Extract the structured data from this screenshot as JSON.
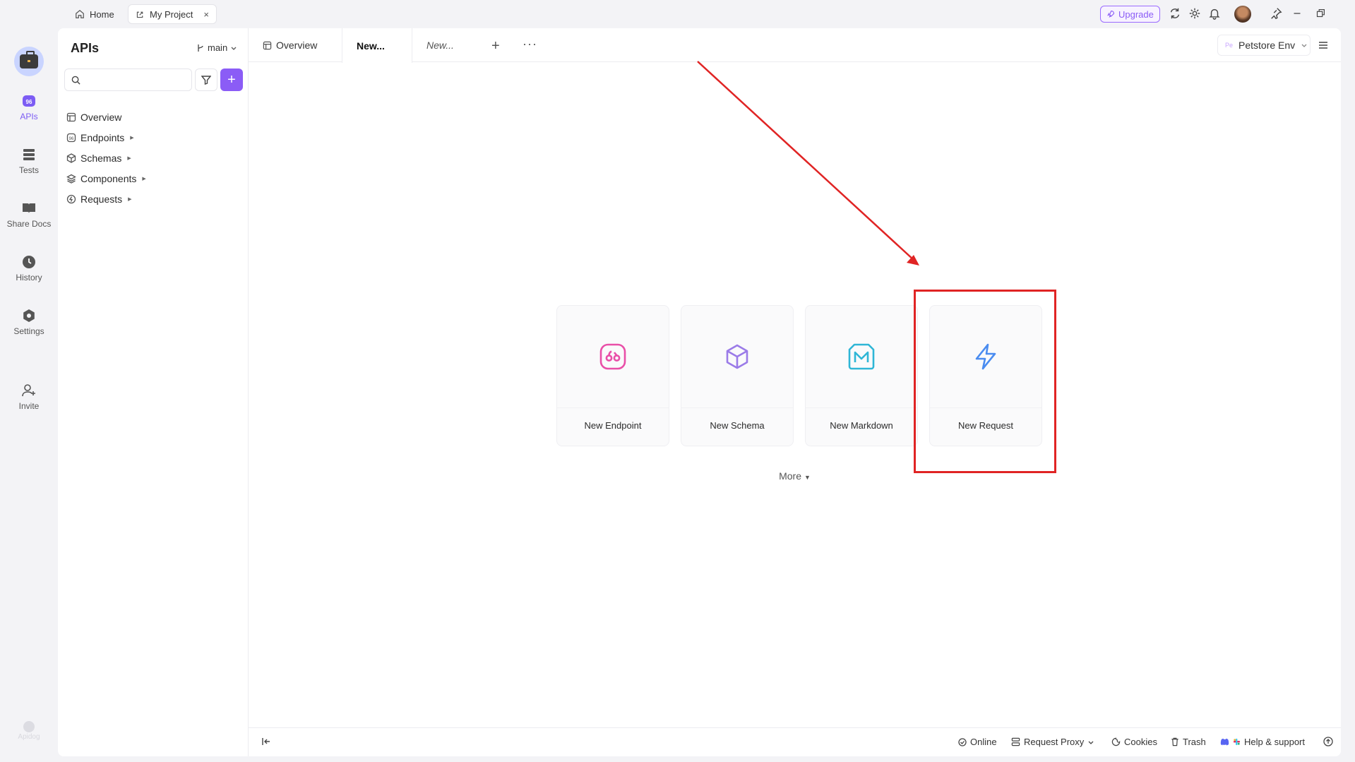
{
  "titlebar": {
    "home_tab": "Home",
    "project_tab": "My Project",
    "close": "×",
    "upgrade": "Upgrade"
  },
  "rail": {
    "items": [
      {
        "label": "APIs",
        "icon": "apis-icon"
      },
      {
        "label": "Tests",
        "icon": "tests-icon"
      },
      {
        "label": "Share Docs",
        "icon": "book-icon"
      },
      {
        "label": "History",
        "icon": "clock-icon"
      },
      {
        "label": "Settings",
        "icon": "gear-icon"
      },
      {
        "label": "Invite",
        "icon": "add-user-icon"
      }
    ],
    "bottom_logo": "Apidog"
  },
  "sidebar": {
    "title": "APIs",
    "branch": "main",
    "search_placeholder": "",
    "add": "+",
    "tree": [
      {
        "label": "Overview",
        "has_caret": false
      },
      {
        "label": "Endpoints",
        "has_caret": true
      },
      {
        "label": "Schemas",
        "has_caret": true
      },
      {
        "label": "Components",
        "has_caret": true
      },
      {
        "label": "Requests",
        "has_caret": true
      }
    ]
  },
  "main": {
    "tabs": [
      {
        "label": "Overview"
      },
      {
        "label": "New..."
      },
      {
        "label": "New..."
      }
    ],
    "plus": "+",
    "more_tabs": "···",
    "env_badge": "Pe",
    "env": "Petstore Env",
    "cards": [
      {
        "label": "New Endpoint",
        "icon": "endpoint-icon",
        "color": "#e94fa8"
      },
      {
        "label": "New Schema",
        "icon": "cube-icon",
        "color": "#9b7be8"
      },
      {
        "label": "New Markdown",
        "icon": "markdown-icon",
        "color": "#2fb6d6"
      },
      {
        "label": "New Request",
        "icon": "lightning-icon",
        "color": "#4a8cf0"
      }
    ],
    "more": "More"
  },
  "statusbar": {
    "online": "Online",
    "request_proxy": "Request Proxy",
    "cookies": "Cookies",
    "trash": "Trash",
    "help": "Help & support"
  },
  "colors": {
    "accent": "#8b5cf6",
    "annotation": "#e02424"
  }
}
